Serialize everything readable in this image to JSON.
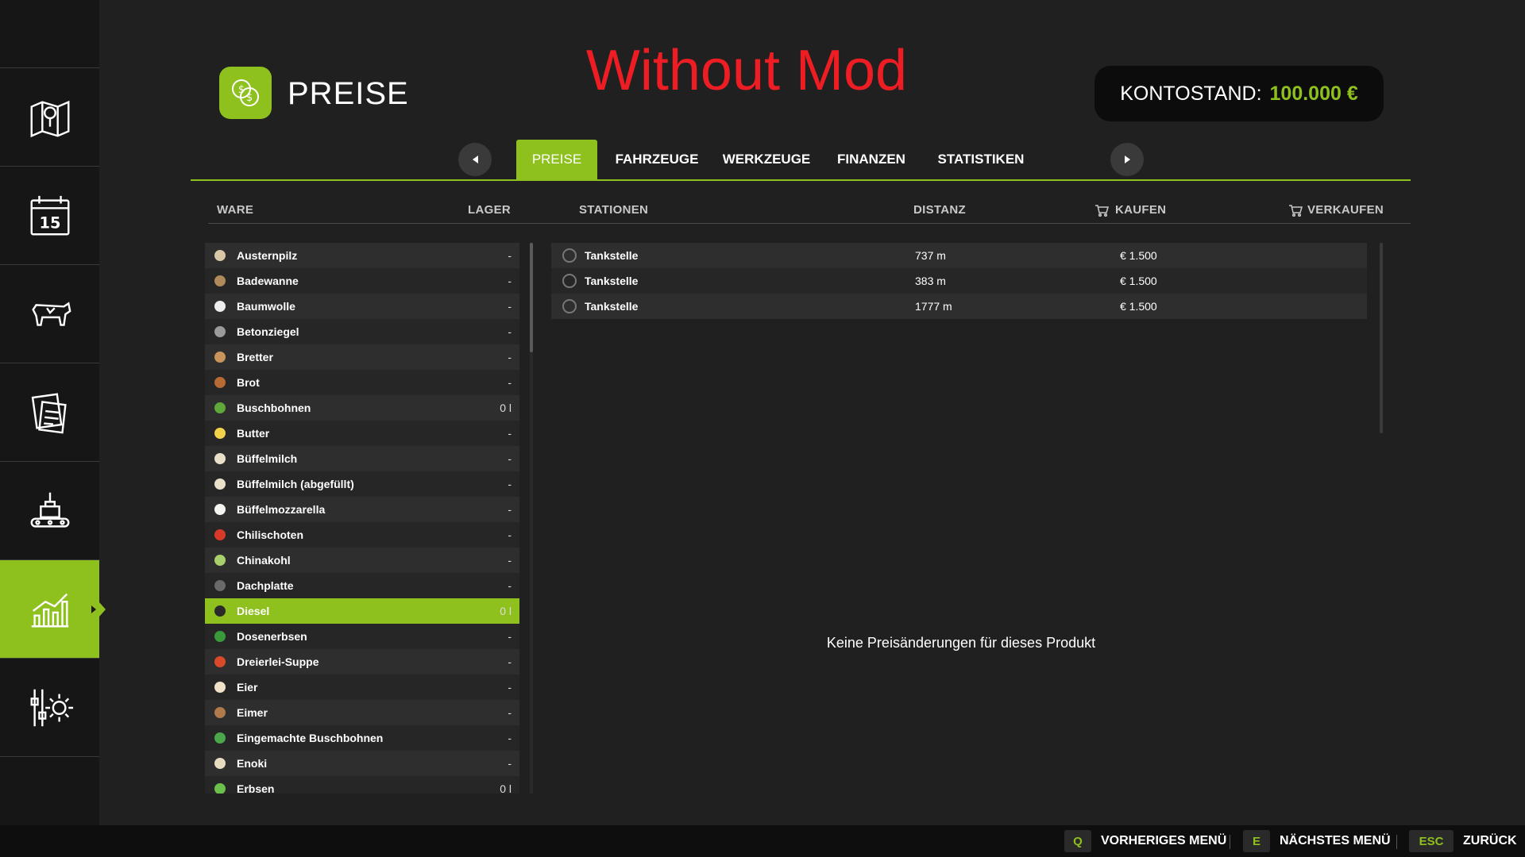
{
  "header": {
    "title": "PREISE",
    "overlay_title": "Without Mod",
    "balance_label": "KONTOSTAND:",
    "balance_value": "100.000 €"
  },
  "sidebar": {
    "items": [
      {
        "icon": "map-icon"
      },
      {
        "icon": "calendar-icon",
        "text": "15"
      },
      {
        "icon": "animals-icon"
      },
      {
        "icon": "contracts-icon"
      },
      {
        "icon": "production-icon"
      },
      {
        "icon": "prices-chart-icon",
        "active": true
      },
      {
        "icon": "settings-icon"
      }
    ]
  },
  "tabs": [
    "PREISE",
    "FAHRZEUGE",
    "WERKZEUGE",
    "FINANZEN",
    "STATISTIKEN"
  ],
  "columns": {
    "ware": "WARE",
    "lager": "LAGER",
    "stationen": "STATIONEN",
    "distanz": "DISTANZ",
    "kaufen": "KAUFEN",
    "verkaufen": "VERKAUFEN"
  },
  "goods": [
    {
      "name": "Austernpilz",
      "stock": "-",
      "color": "#d9c8a8"
    },
    {
      "name": "Badewanne",
      "stock": "-",
      "color": "#b08a5a"
    },
    {
      "name": "Baumwolle",
      "stock": "-",
      "color": "#eeeeee"
    },
    {
      "name": "Betonziegel",
      "stock": "-",
      "color": "#9a9a9a"
    },
    {
      "name": "Bretter",
      "stock": "-",
      "color": "#c8945a"
    },
    {
      "name": "Brot",
      "stock": "-",
      "color": "#b86a34"
    },
    {
      "name": "Buschbohnen",
      "stock": "0 l",
      "color": "#5fa83a"
    },
    {
      "name": "Butter",
      "stock": "-",
      "color": "#f2d24a"
    },
    {
      "name": "Büffelmilch",
      "stock": "-",
      "color": "#e8e0c8"
    },
    {
      "name": "Büffelmilch (abgefüllt)",
      "stock": "-",
      "color": "#e8e0c8"
    },
    {
      "name": "Büffelmozzarella",
      "stock": "-",
      "color": "#f4f4f0"
    },
    {
      "name": "Chilischoten",
      "stock": "-",
      "color": "#d83a2a"
    },
    {
      "name": "Chinakohl",
      "stock": "-",
      "color": "#a8d06a"
    },
    {
      "name": "Dachplatte",
      "stock": "-",
      "color": "#6a6a6a"
    },
    {
      "name": "Diesel",
      "stock": "0 l",
      "color": "#2a2a2a",
      "selected": true
    },
    {
      "name": "Dosenerbsen",
      "stock": "-",
      "color": "#3a9a3a"
    },
    {
      "name": "Dreierlei-Suppe",
      "stock": "-",
      "color": "#d84a2a"
    },
    {
      "name": "Eier",
      "stock": "-",
      "color": "#f0e2c8"
    },
    {
      "name": "Eimer",
      "stock": "-",
      "color": "#b07a4a"
    },
    {
      "name": "Eingemachte Buschbohnen",
      "stock": "-",
      "color": "#4aa84a"
    },
    {
      "name": "Enoki",
      "stock": "-",
      "color": "#e8dcc0"
    },
    {
      "name": "Erbsen",
      "stock": "0 l",
      "color": "#6ac04a"
    }
  ],
  "stations": [
    {
      "name": "Tankstelle",
      "distance": "737 m",
      "price": "€ 1.500"
    },
    {
      "name": "Tankstelle",
      "distance": "383 m",
      "price": "€ 1.500"
    },
    {
      "name": "Tankstelle",
      "distance": "1777 m",
      "price": "€ 1.500"
    }
  ],
  "no_changes": "Keine Preisänderungen für dieses Produkt",
  "bottom": {
    "prev_key": "Q",
    "prev_label": "VORHERIGES MENÜ",
    "next_key": "E",
    "next_label": "NÄCHSTES MENÜ",
    "back_key": "ESC",
    "back_label": "ZURÜCK"
  },
  "colors": {
    "accent": "#8ec01e",
    "overlay_red": "#ee1d23"
  }
}
